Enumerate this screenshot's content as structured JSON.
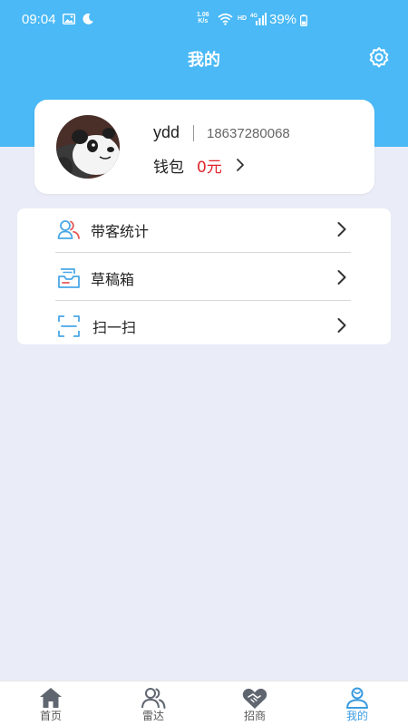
{
  "status_bar": {
    "time": "09:04",
    "net_speed_value": "1.06",
    "net_speed_unit": "K/s",
    "hd_label": "HD",
    "network_type": "4G",
    "battery": "39%"
  },
  "header": {
    "title": "我的",
    "settings_icon": "gear-icon"
  },
  "profile": {
    "username": "ydd",
    "phone": "18637280068",
    "wallet_label": "钱包",
    "wallet_amount": "0元"
  },
  "menu": {
    "items": [
      {
        "label": "带客统计",
        "icon": "users-icon"
      },
      {
        "label": "草稿箱",
        "icon": "drafts-icon"
      },
      {
        "label": "扫一扫",
        "icon": "scan-icon"
      }
    ]
  },
  "bottom_nav": {
    "items": [
      {
        "label": "首页",
        "icon": "home-icon"
      },
      {
        "label": "雷达",
        "icon": "radar-icon"
      },
      {
        "label": "招商",
        "icon": "handshake-icon"
      },
      {
        "label": "我的",
        "icon": "profile-icon"
      }
    ],
    "active": "我的"
  },
  "colors": {
    "header": "#4ab9f6",
    "background": "#eaedf7",
    "wallet_amount": "#e0242b",
    "active_tab": "#3a9be0",
    "menu_icon": "#4aa7e8"
  }
}
